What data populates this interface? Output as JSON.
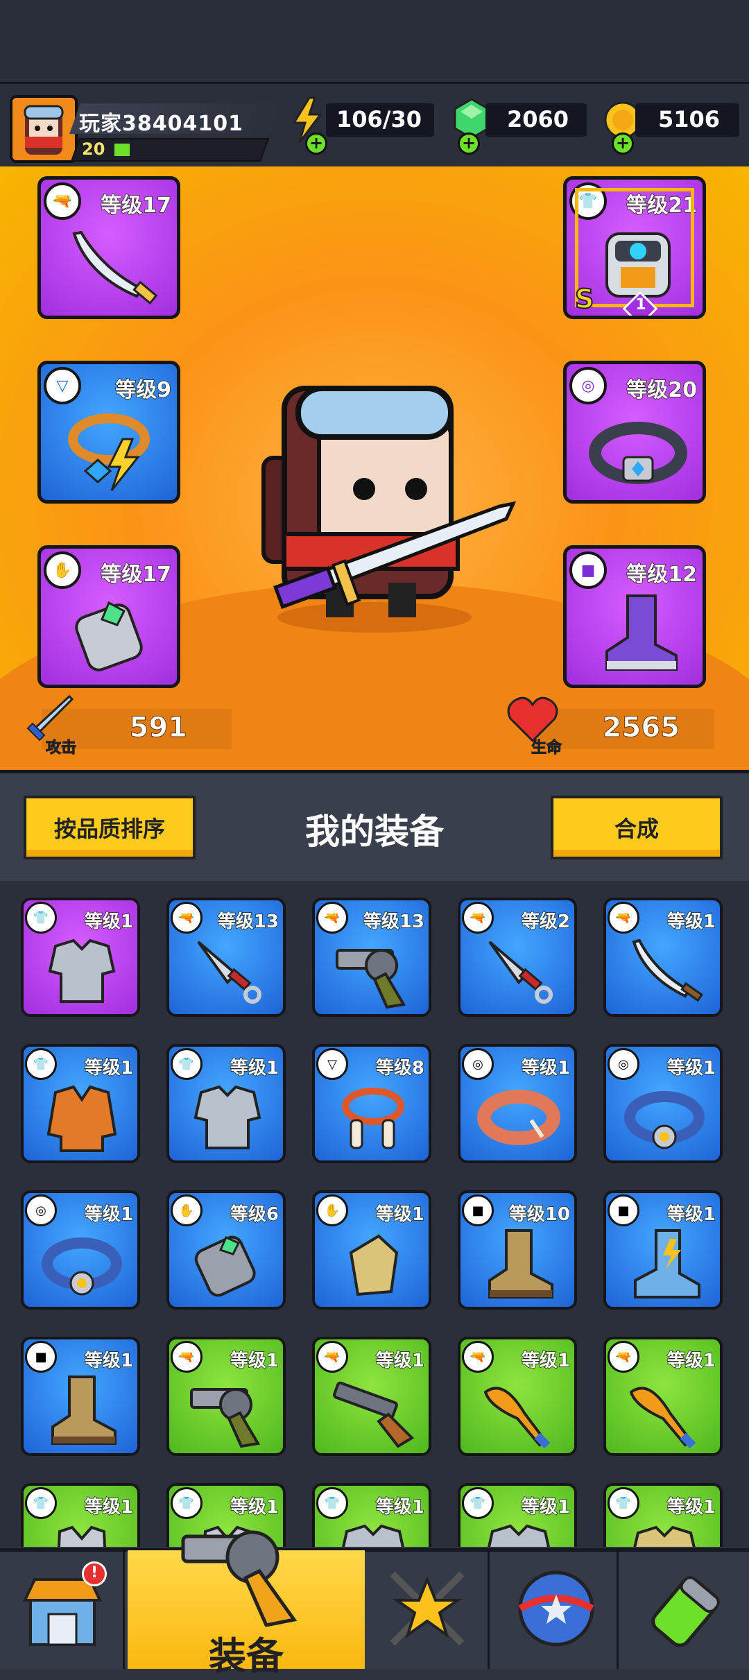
{
  "player": {
    "name": "玩家38404101",
    "level": "20",
    "xp_fraction": 0.1
  },
  "resources": {
    "energy": "106/30",
    "gems": "2060",
    "coins": "5106"
  },
  "hero_slots": [
    {
      "slot": "weapon",
      "level_label": "等级17",
      "rarity": "purple",
      "icon": "scimitar-icon"
    },
    {
      "slot": "necklace",
      "level_label": "等级9",
      "rarity": "blue",
      "icon": "amulet-icon"
    },
    {
      "slot": "gloves",
      "level_label": "等级17",
      "rarity": "purple",
      "icon": "gauntlet-icon"
    },
    {
      "slot": "armor",
      "level_label": "等级21",
      "rarity": "purple",
      "grade": "S",
      "stars": "1",
      "icon": "robot-armor-icon"
    },
    {
      "slot": "belt",
      "level_label": "等级20",
      "rarity": "purple",
      "icon": "belt-icon"
    },
    {
      "slot": "boots",
      "level_label": "等级12",
      "rarity": "purple",
      "icon": "boot-icon"
    }
  ],
  "stats": {
    "attack_label": "攻击",
    "attack": "591",
    "hp_label": "生命",
    "hp": "2565"
  },
  "toolbar": {
    "sort_label": "按品质排序",
    "title": "我的装备",
    "merge_label": "合成"
  },
  "inventory": [
    {
      "level_label": "等级1",
      "rarity": "purple",
      "icon": "armor-icon"
    },
    {
      "level_label": "等级13",
      "rarity": "blue",
      "icon": "kunai-icon"
    },
    {
      "level_label": "等级13",
      "rarity": "blue",
      "icon": "revolver-icon"
    },
    {
      "level_label": "等级2",
      "rarity": "blue",
      "icon": "kunai-icon"
    },
    {
      "level_label": "等级1",
      "rarity": "blue",
      "icon": "scimitar-icon"
    },
    {
      "level_label": "等级1",
      "rarity": "blue",
      "icon": "jacket-icon"
    },
    {
      "level_label": "等级1",
      "rarity": "blue",
      "icon": "armor-icon"
    },
    {
      "level_label": "等级8",
      "rarity": "blue",
      "icon": "bone-necklace-icon"
    },
    {
      "level_label": "等级1",
      "rarity": "blue",
      "icon": "leather-belt-icon"
    },
    {
      "level_label": "等级1",
      "rarity": "blue",
      "icon": "belt-icon"
    },
    {
      "level_label": "等级1",
      "rarity": "blue",
      "icon": "belt-icon"
    },
    {
      "level_label": "等级6",
      "rarity": "blue",
      "icon": "gauntlet-icon"
    },
    {
      "level_label": "等级1",
      "rarity": "blue",
      "icon": "glove-icon"
    },
    {
      "level_label": "等级10",
      "rarity": "blue",
      "icon": "boot-icon"
    },
    {
      "level_label": "等级1",
      "rarity": "blue",
      "icon": "sneaker-icon"
    },
    {
      "level_label": "等级1",
      "rarity": "blue",
      "icon": "boot-icon"
    },
    {
      "level_label": "等级1",
      "rarity": "green",
      "icon": "revolver-icon"
    },
    {
      "level_label": "等级1",
      "rarity": "green",
      "icon": "shotgun-icon"
    },
    {
      "level_label": "等级1",
      "rarity": "green",
      "icon": "bat-icon"
    },
    {
      "level_label": "等级1",
      "rarity": "green",
      "icon": "bat-icon"
    },
    {
      "level_label": "等级1",
      "rarity": "green",
      "icon": "vest-icon"
    },
    {
      "level_label": "等级1",
      "rarity": "green",
      "icon": "vest-icon"
    },
    {
      "level_label": "等级1",
      "rarity": "green",
      "icon": "armor-icon"
    },
    {
      "level_label": "等级1",
      "rarity": "green",
      "icon": "armor-icon"
    },
    {
      "level_label": "等级1",
      "rarity": "green",
      "icon": "shirt-icon"
    }
  ],
  "nav": {
    "equipment_label": "装备",
    "shop_badge": "!"
  },
  "colors": {
    "purple": "#a12fe0",
    "blue": "#1e64d8",
    "green": "#4fb81e",
    "orange": "#fb9316",
    "yellow": "#fecb1c"
  }
}
